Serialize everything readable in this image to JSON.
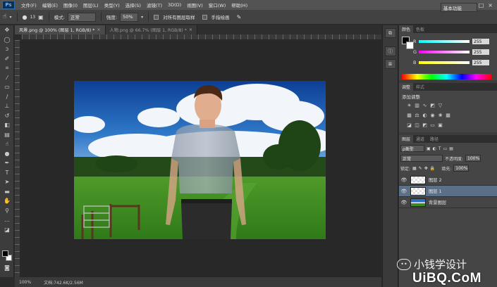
{
  "app": {
    "logo": "Ps"
  },
  "menu": [
    "文件(F)",
    "编辑(E)",
    "图像(I)",
    "图层(L)",
    "类型(Y)",
    "选择(S)",
    "滤镜(T)",
    "3D(D)",
    "视图(V)",
    "窗口(W)",
    "帮助(H)"
  ],
  "window_controls": [
    "–",
    "□",
    "×"
  ],
  "options_bar": {
    "brush_size": "13",
    "mode_label": "模式:",
    "mode_value": "正常",
    "strength_label": "强度:",
    "strength_value": "50%",
    "sample_all_label": "对所有图层取样",
    "finger_paint_label": "手指绘画",
    "workspace": "基本功能"
  },
  "tabs": [
    {
      "label": "风景.png @ 100% (图层 1, RGB/8) *",
      "active": true
    },
    {
      "label": "人物.png @ 66.7% (图层 1, RGB/8) *",
      "active": false
    }
  ],
  "status": {
    "zoom": "100%",
    "doc": "文档:742.6K/2.56M"
  },
  "color_panel": {
    "tabs": [
      "颜色",
      "色板"
    ],
    "channels": [
      {
        "letter": "R",
        "value": "255"
      },
      {
        "letter": "G",
        "value": "255"
      },
      {
        "letter": "B",
        "value": "255"
      }
    ]
  },
  "adjust_panel": {
    "tabs": [
      "调整",
      "样式"
    ],
    "title": "添加调整"
  },
  "layers_panel": {
    "tabs": [
      "图层",
      "通道",
      "路径"
    ],
    "kind_filter": "ρ类型",
    "blend_mode": "正常",
    "opacity_label": "不透明度:",
    "opacity_value": "100%",
    "lock_label": "锁定:",
    "fill_label": "填充:",
    "fill_value": "100%",
    "layers": [
      {
        "name": "图层 2",
        "selected": false
      },
      {
        "name": "图层 1",
        "selected": true
      },
      {
        "name": "背景图层",
        "selected": false
      }
    ]
  },
  "watermark": {
    "brand": "小钱学设计",
    "site": "UiBQ.CoM"
  },
  "colors": {
    "accent": "#5b6f86",
    "sky": "#1f5fb0",
    "grass": "#3e8a22"
  }
}
